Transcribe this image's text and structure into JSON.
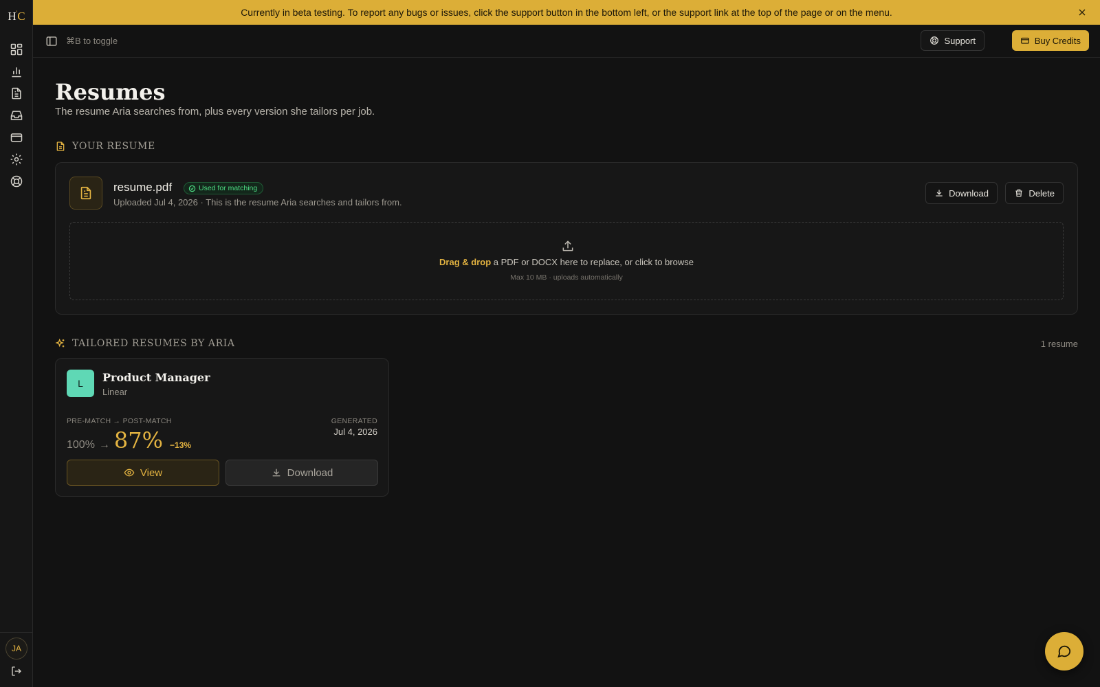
{
  "brand": {
    "logo_left": "H",
    "logo_right": "C",
    "accent": "#dcae37"
  },
  "sidebar": {
    "items": [
      {
        "icon": "dashboard-icon"
      },
      {
        "icon": "analytics-icon"
      },
      {
        "icon": "resume-icon"
      },
      {
        "icon": "inbox-icon"
      },
      {
        "icon": "billing-icon"
      },
      {
        "icon": "settings-icon"
      },
      {
        "icon": "help-icon"
      }
    ],
    "avatar_initials": "JA",
    "logout_icon": "logout-icon"
  },
  "banner": {
    "text": "Currently in beta testing. To report any bugs or issues, click the support button in the bottom left, or the support link at the top of the page or on the menu."
  },
  "topbar": {
    "toggle_hint": "⌘B to toggle",
    "support_label": "Support",
    "credits_label": "Buy Credits"
  },
  "page": {
    "title": "Resumes",
    "subtitle": "The resume Aria searches from, plus every version she tailors per job."
  },
  "your_resume": {
    "heading": "YOUR RESUME",
    "file_name": "resume.pdf",
    "badge": "Used for matching",
    "meta": "Uploaded Jul 4, 2026 · This is the resume Aria searches and tailors from.",
    "download_label": "Download",
    "delete_label": "Delete",
    "dropzone": {
      "highlight": "Drag & drop",
      "text": " a PDF or DOCX here to replace, or click to browse",
      "sub": "Max 10 MB · uploads automatically"
    }
  },
  "tailored": {
    "heading": "TAILORED RESUMES BY ARIA",
    "count": "1 resume",
    "items": [
      {
        "company_initial": "L",
        "title": "Product Manager",
        "company": "Linear",
        "score_label": "PRE-MATCH → POST-MATCH",
        "pre_score": "100%",
        "arrow": "→",
        "post_score": "87%",
        "delta": "−13%",
        "generated_label": "GENERATED",
        "generated_date": "Jul 4, 2026",
        "view_label": "View",
        "download_label": "Download"
      }
    ]
  }
}
